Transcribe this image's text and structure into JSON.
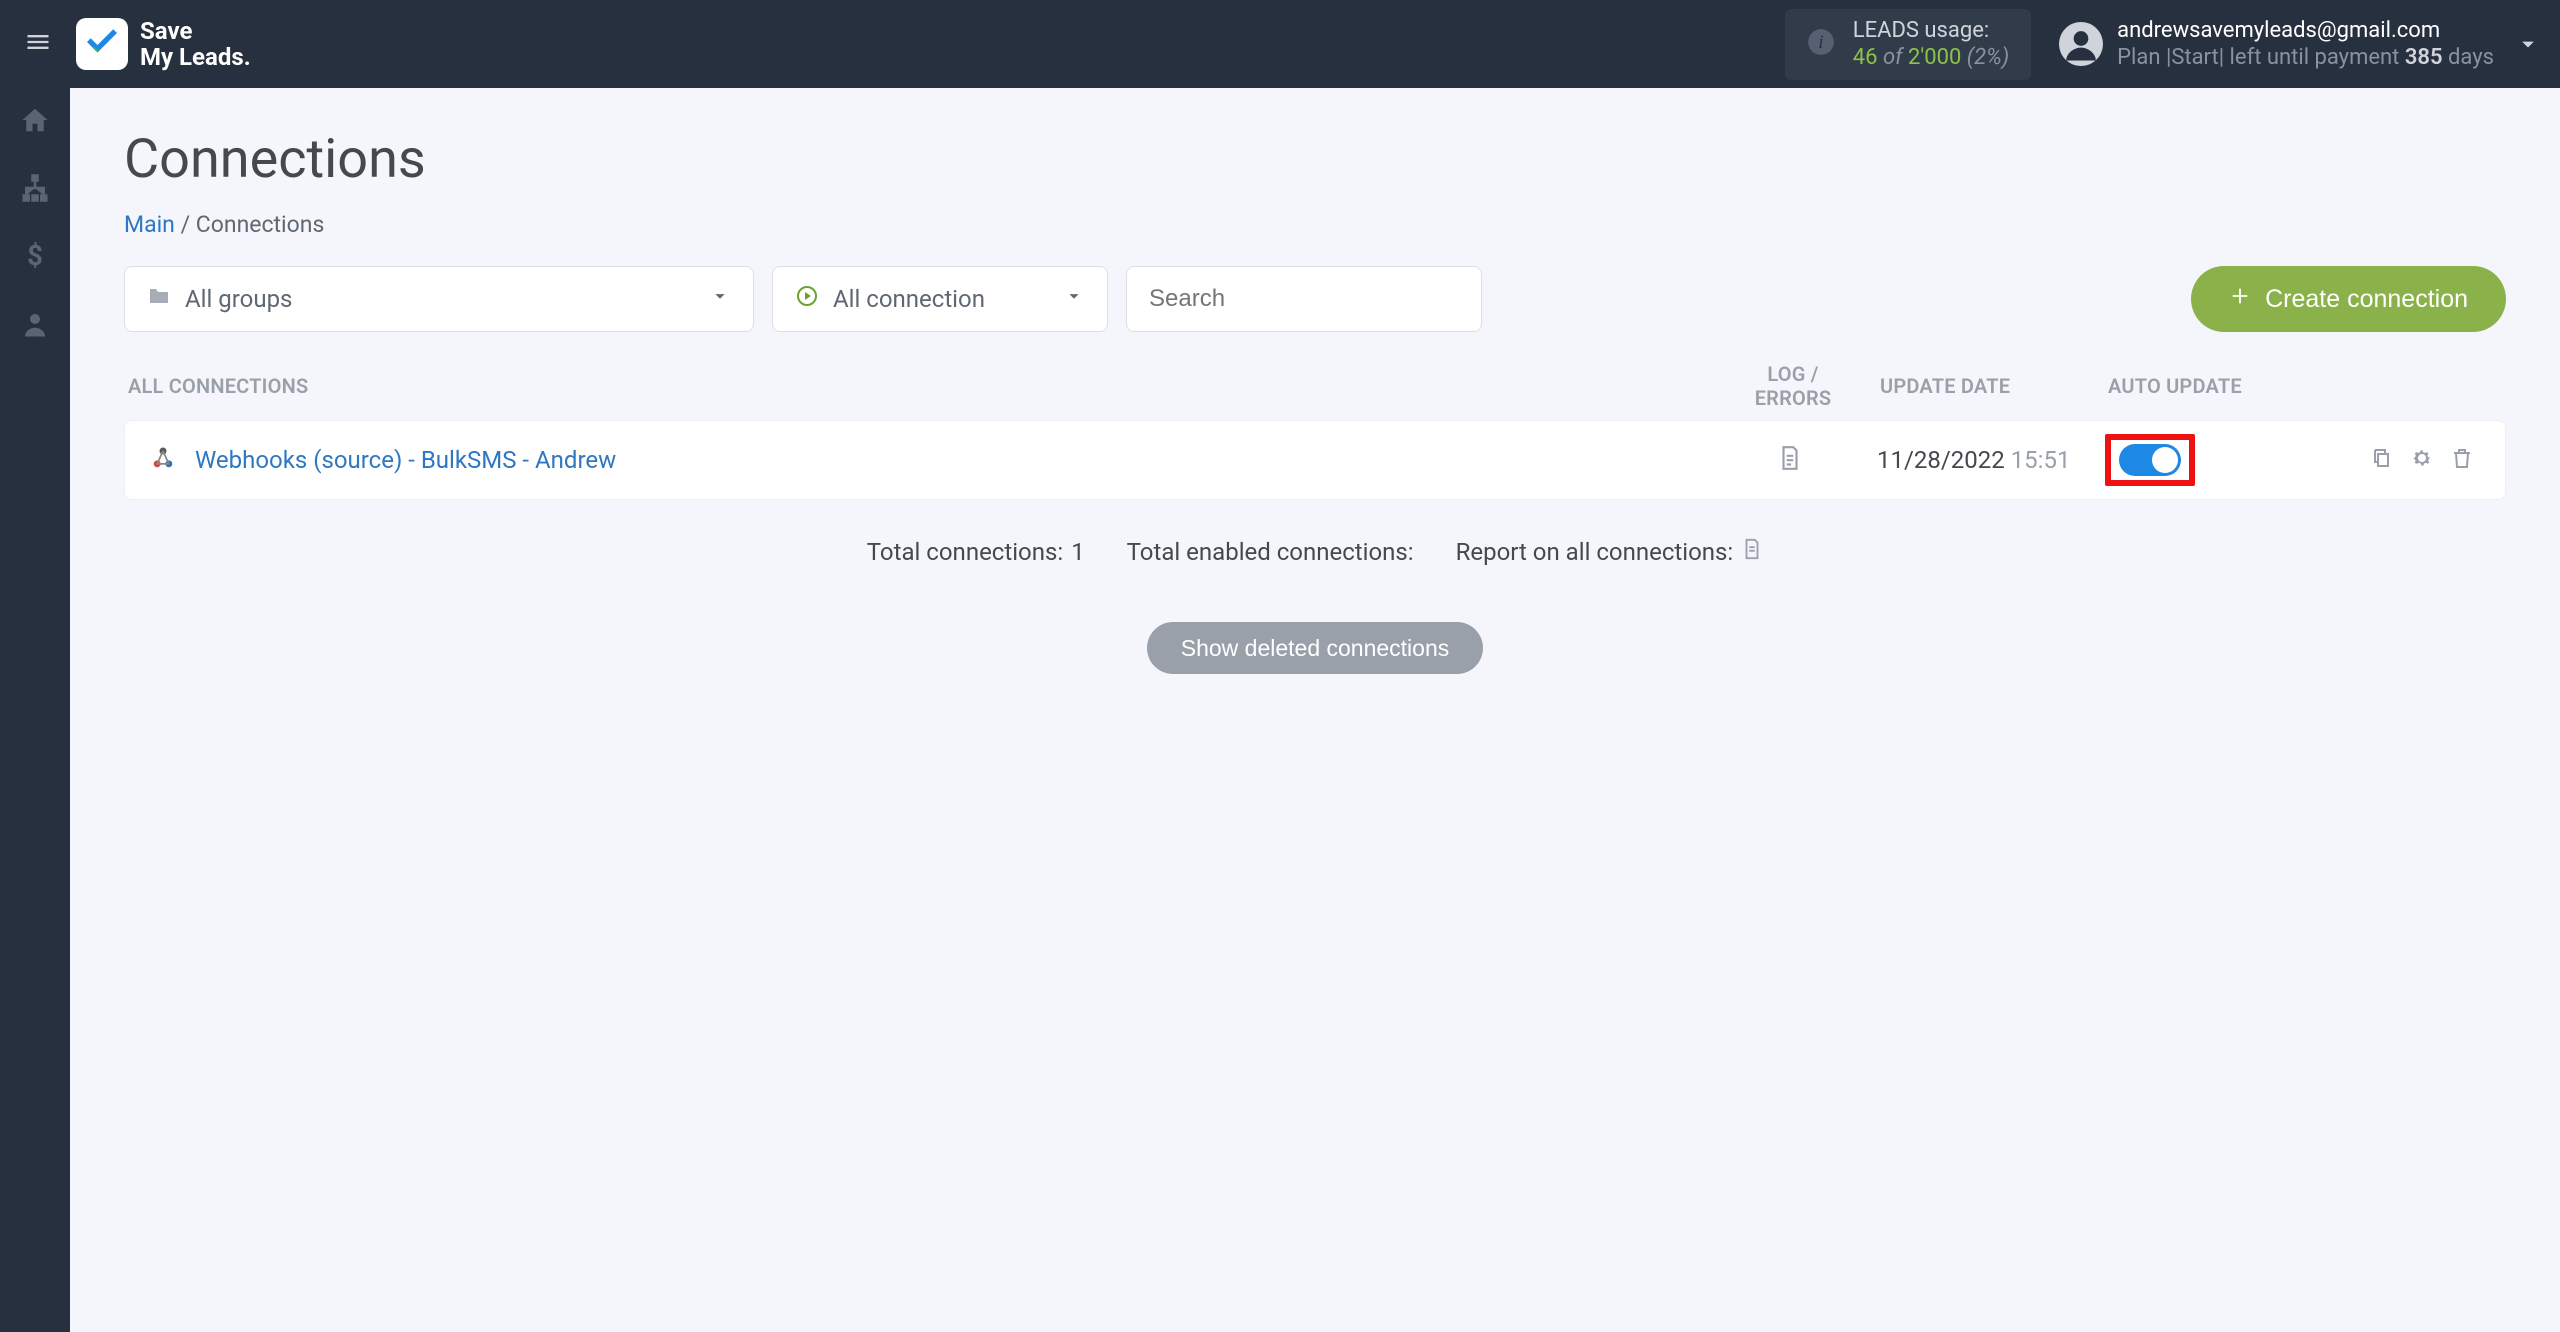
{
  "brand": {
    "line1": "Save",
    "line2": "My Leads."
  },
  "usage": {
    "label": "LEADS usage:",
    "used": "46",
    "of": "of",
    "total": "2'000",
    "pct": "(2%)"
  },
  "account": {
    "email": "andrewsavemyleads@gmail.com",
    "plan_prefix": "Plan |Start| left until payment ",
    "plan_days": "385",
    "plan_suffix": " days"
  },
  "page": {
    "title": "Connections",
    "breadcrumb_main": "Main",
    "breadcrumb_sep": " / ",
    "breadcrumb_current": "Connections"
  },
  "filters": {
    "groups_label": "All groups",
    "conn_label": "All connection",
    "search_placeholder": "Search"
  },
  "buttons": {
    "create": "Create connection",
    "show_deleted": "Show deleted connections"
  },
  "columns": {
    "all": "ALL CONNECTIONS",
    "log": "LOG / ERRORS",
    "update": "UPDATE DATE",
    "auto": "AUTO UPDATE"
  },
  "rows": [
    {
      "name": "Webhooks (source) - BulkSMS - Andrew",
      "update_date": "11/28/2022",
      "update_time": "15:51",
      "auto_on": true
    }
  ],
  "summary": {
    "total_label": "Total connections: ",
    "total_value": "1",
    "enabled_label": "Total enabled connections:",
    "report_label": "Report on all connections:"
  }
}
